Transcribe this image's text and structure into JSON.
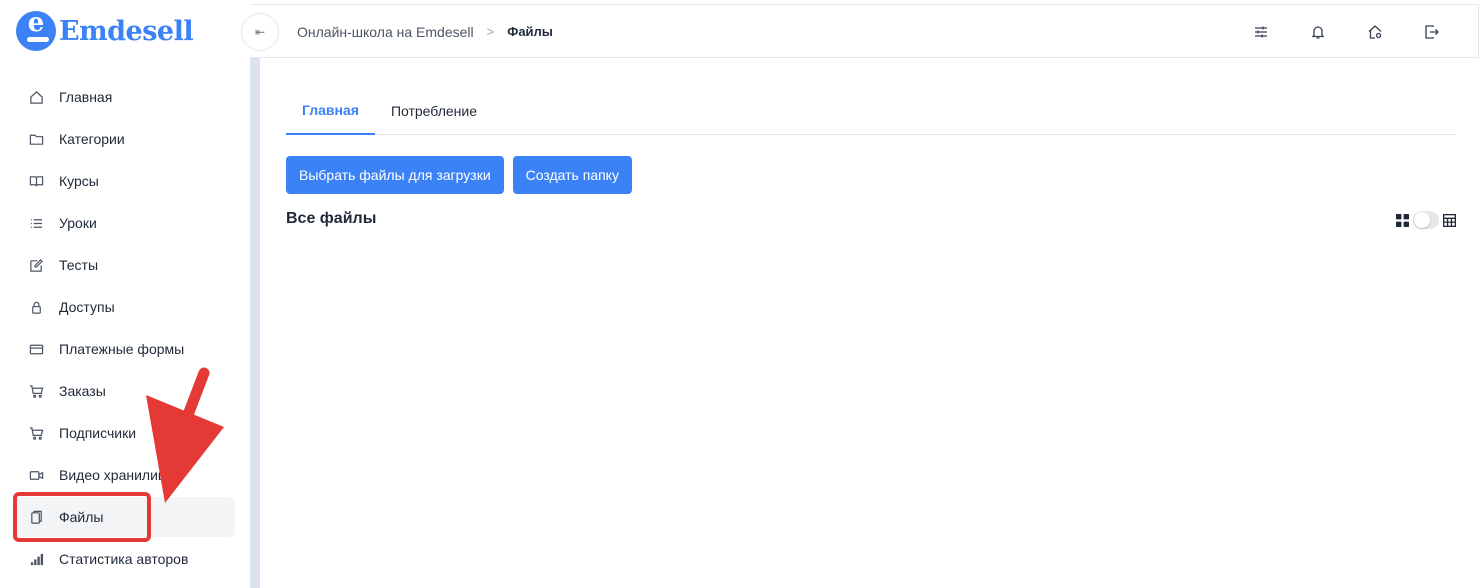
{
  "brand": {
    "name": "Emdesell",
    "logo_letter": "e",
    "color": "#3b82f6"
  },
  "sidebar": {
    "items": [
      {
        "label": "Главная",
        "icon": "home-icon"
      },
      {
        "label": "Категории",
        "icon": "folder-icon"
      },
      {
        "label": "Курсы",
        "icon": "book-icon"
      },
      {
        "label": "Уроки",
        "icon": "list-icon"
      },
      {
        "label": "Тесты",
        "icon": "edit-icon"
      },
      {
        "label": "Доступы",
        "icon": "lock-icon"
      },
      {
        "label": "Платежные формы",
        "icon": "credit-card-icon"
      },
      {
        "label": "Заказы",
        "icon": "cart-icon"
      },
      {
        "label": "Подписчики",
        "icon": "cart-icon"
      },
      {
        "label": "Видео хранилище",
        "icon": "video-icon"
      },
      {
        "label": "Файлы",
        "icon": "file-icon",
        "active": true
      },
      {
        "label": "Статистика авторов",
        "icon": "bar-chart-icon"
      }
    ]
  },
  "header": {
    "collapse_icon": "collapse-sidebar-icon",
    "breadcrumb": {
      "parent": "Онлайн-школа на Emdesell",
      "separator": ">",
      "current": "Файлы"
    },
    "icons": [
      "sliders-icon",
      "bell-icon",
      "home-settings-icon",
      "logout-icon"
    ]
  },
  "main": {
    "tabs": [
      {
        "label": "Главная",
        "active": true
      },
      {
        "label": "Потребление",
        "active": false
      }
    ],
    "buttons": {
      "upload": "Выбрать файлы для загрузки",
      "create_folder": "Создать папку"
    },
    "section_title": "Все файлы",
    "view_toggle": {
      "left_icon": "grid-view-icon",
      "right_icon": "table-view-icon",
      "state": "grid"
    }
  },
  "annotation": {
    "highlight_color": "#e53935",
    "target": "Файлы"
  }
}
